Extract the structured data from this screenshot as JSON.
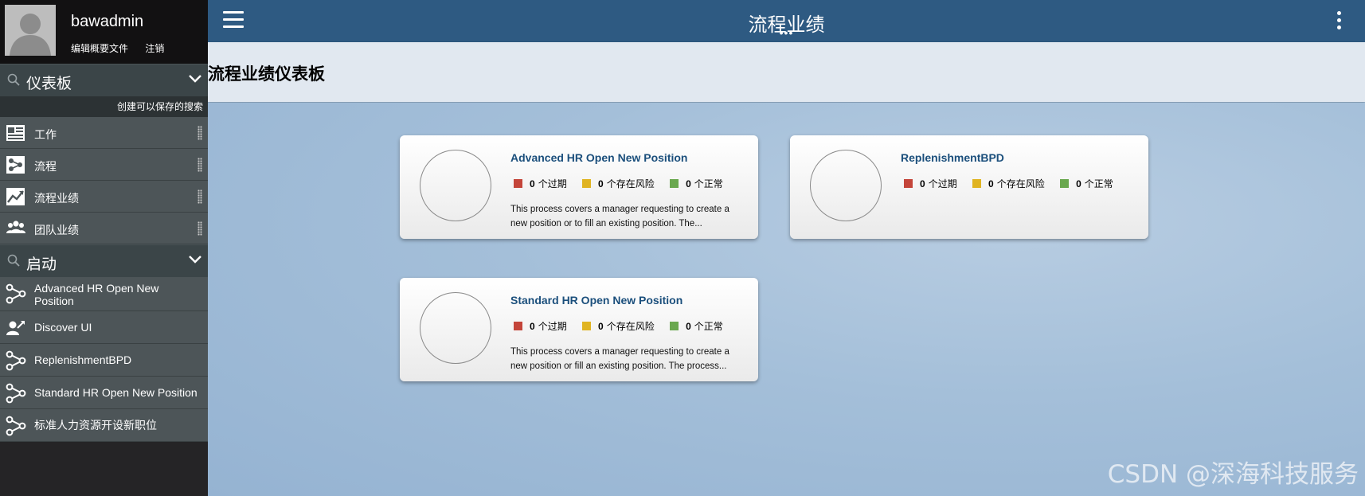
{
  "profile": {
    "username": "bawadmin",
    "edit_profile": "编辑概要文件",
    "logout": "注销"
  },
  "dashboards": {
    "section_title": "仪表板",
    "saved_search_label": "创建可以保存的搜索",
    "items": [
      {
        "label": "工作",
        "icon": "work-icon"
      },
      {
        "label": "流程",
        "icon": "process-icon"
      },
      {
        "label": "流程业绩",
        "icon": "trend-icon"
      },
      {
        "label": "团队业绩",
        "icon": "team-icon"
      }
    ]
  },
  "launch": {
    "section_title": "启动",
    "items": [
      {
        "label": "Advanced HR Open New Position",
        "icon": "process-flow-icon"
      },
      {
        "label": "Discover UI",
        "icon": "discover-user-icon"
      },
      {
        "label": "ReplenishmentBPD",
        "icon": "process-flow-icon"
      },
      {
        "label": "Standard HR Open New Position",
        "icon": "process-flow-icon"
      },
      {
        "label": "标准人力资源开设新职位",
        "icon": "process-flow-icon"
      }
    ]
  },
  "topbar": {
    "title": "流程业绩",
    "dots": "•••"
  },
  "page": {
    "heading": "流程业绩仪表板"
  },
  "status_colors": {
    "overdue": "#c4453a",
    "at_risk": "#e0b422",
    "on_track": "#6aa84f"
  },
  "cards": [
    {
      "title": "Advanced HR Open New Position",
      "overdue_count": "0",
      "overdue_label": "个过期",
      "at_risk_count": "0",
      "at_risk_label": "个存在风险",
      "on_track_count": "0",
      "on_track_label": "个正常",
      "description": "This process covers a manager requesting to create a new position or to fill an existing position. The..."
    },
    {
      "title": "ReplenishmentBPD",
      "overdue_count": "0",
      "overdue_label": "个过期",
      "at_risk_count": "0",
      "at_risk_label": "个存在风险",
      "on_track_count": "0",
      "on_track_label": "个正常",
      "description": ""
    },
    {
      "title": "Standard HR Open New Position",
      "overdue_count": "0",
      "overdue_label": "个过期",
      "at_risk_count": "0",
      "at_risk_label": "个存在风险",
      "on_track_count": "0",
      "on_track_label": "个正常",
      "description": "This process covers a manager requesting to create a new position or fill an existing position. The process..."
    }
  ],
  "watermark": "CSDN @深海科技服务"
}
